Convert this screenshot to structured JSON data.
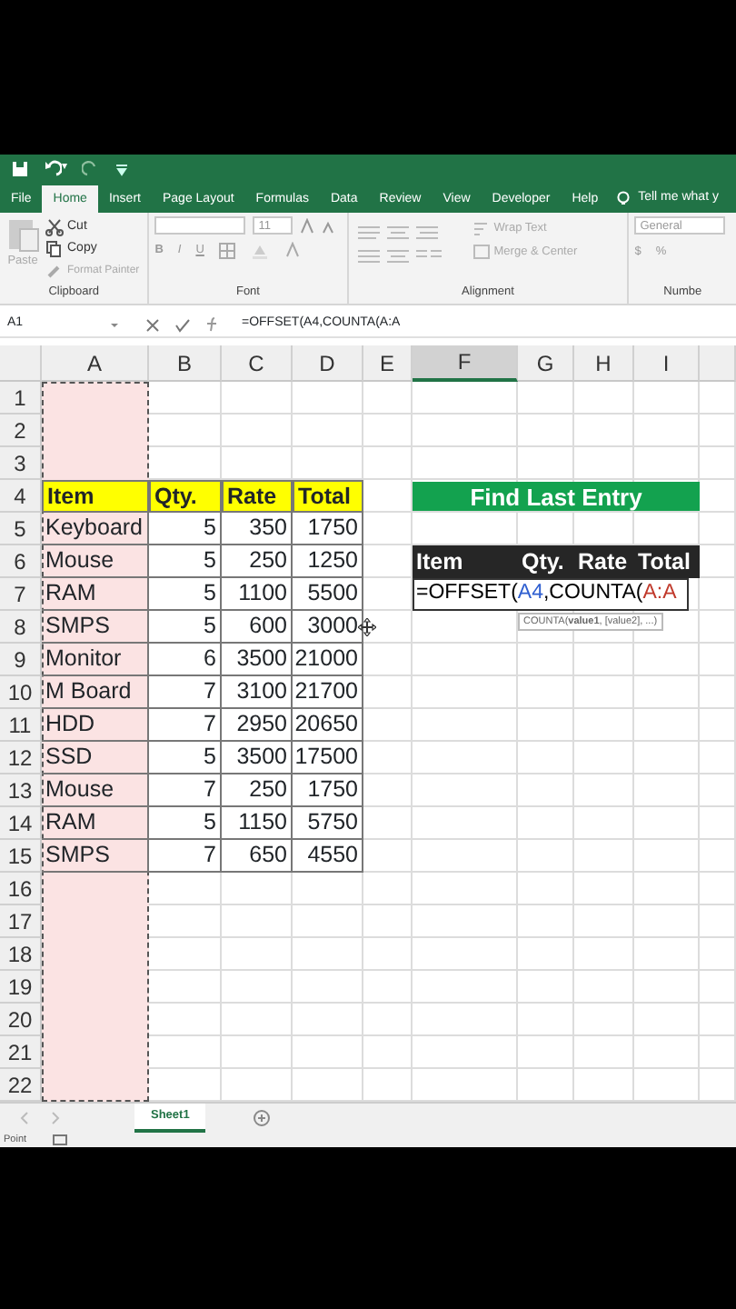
{
  "quick_access": {
    "undo_caret": "▾"
  },
  "ribbon_tabs": [
    {
      "label": "File",
      "selected": false
    },
    {
      "label": "Home",
      "selected": true
    },
    {
      "label": "Insert",
      "selected": false
    },
    {
      "label": "Page Layout",
      "selected": false
    },
    {
      "label": "Formulas",
      "selected": false
    },
    {
      "label": "Data",
      "selected": false
    },
    {
      "label": "Review",
      "selected": false
    },
    {
      "label": "View",
      "selected": false
    },
    {
      "label": "Developer",
      "selected": false
    },
    {
      "label": "Help",
      "selected": false
    }
  ],
  "tell_me": "Tell me what y",
  "ribbon": {
    "clipboard": {
      "paste": "Paste",
      "commands": [
        "Cut",
        "Copy",
        "Format Painter"
      ],
      "label": "Clipboard"
    },
    "font": {
      "size": "11",
      "format_buttons": [
        "B",
        "I",
        "U"
      ],
      "label": "Font"
    },
    "alignment": {
      "commands": [
        "Wrap Text",
        "Merge & Center"
      ],
      "label": "Alignment"
    },
    "number": {
      "format": "General",
      "symbols": [
        "$",
        "%"
      ],
      "label": "Numbe"
    }
  },
  "formula_bar": {
    "name_box": "A1",
    "formula": "=OFFSET(A4,COUNTA(A:A"
  },
  "sheet": {
    "columns": [
      {
        "label": "A",
        "selected": false,
        "copied": true
      },
      {
        "label": "B",
        "selected": false,
        "copied": false
      },
      {
        "label": "C",
        "selected": false,
        "copied": false
      },
      {
        "label": "D",
        "selected": false,
        "copied": false
      },
      {
        "label": "E",
        "selected": false,
        "copied": false
      },
      {
        "label": "F",
        "selected": true,
        "copied": false
      },
      {
        "label": "G",
        "selected": false,
        "copied": false
      },
      {
        "label": "H",
        "selected": false,
        "copied": false
      },
      {
        "label": "I",
        "selected": false,
        "copied": false
      }
    ],
    "row_numbers": [
      "1",
      "2",
      "3",
      "4",
      "5",
      "6",
      "7",
      "8",
      "9",
      "10",
      "11",
      "12",
      "13",
      "14",
      "15",
      "16",
      "17",
      "18",
      "19",
      "20",
      "21",
      "22"
    ],
    "data_table": {
      "header": [
        "Item",
        "Qty.",
        "Rate",
        "Total"
      ],
      "rows": [
        [
          "Keyboard",
          "5",
          "350",
          "1750"
        ],
        [
          "Mouse",
          "5",
          "250",
          "1250"
        ],
        [
          "RAM",
          "5",
          "1100",
          "5500"
        ],
        [
          "SMPS",
          "5",
          "600",
          "3000"
        ],
        [
          "Monitor",
          "6",
          "3500",
          "21000"
        ],
        [
          "M Board",
          "7",
          "3100",
          "21700"
        ],
        [
          "HDD",
          "7",
          "2950",
          "20650"
        ],
        [
          "SSD",
          "5",
          "3500",
          "17500"
        ],
        [
          "Mouse",
          "7",
          "250",
          "1750"
        ],
        [
          "RAM",
          "5",
          "1150",
          "5750"
        ],
        [
          "SMPS",
          "7",
          "650",
          "4550"
        ]
      ]
    },
    "banner": "Find Last Entry",
    "lookup_table": {
      "header": [
        "Item",
        "Qty.",
        "Rate",
        "Total"
      ]
    },
    "editing_cell": {
      "segments": [
        {
          "text": "=OFFSET(",
          "color": "#000000"
        },
        {
          "text": "A4",
          "color": "#2f5fd0"
        },
        {
          "text": ",COUNTA(",
          "color": "#000000"
        },
        {
          "text": "A:A",
          "color": "#c0392b"
        }
      ]
    },
    "tooltip": "COUNTA(**value1**, [value2], ...)"
  },
  "sheet_tabs": [
    {
      "label": "Sheet1",
      "selected": true
    }
  ],
  "status_bar": {
    "mode": "Point"
  }
}
